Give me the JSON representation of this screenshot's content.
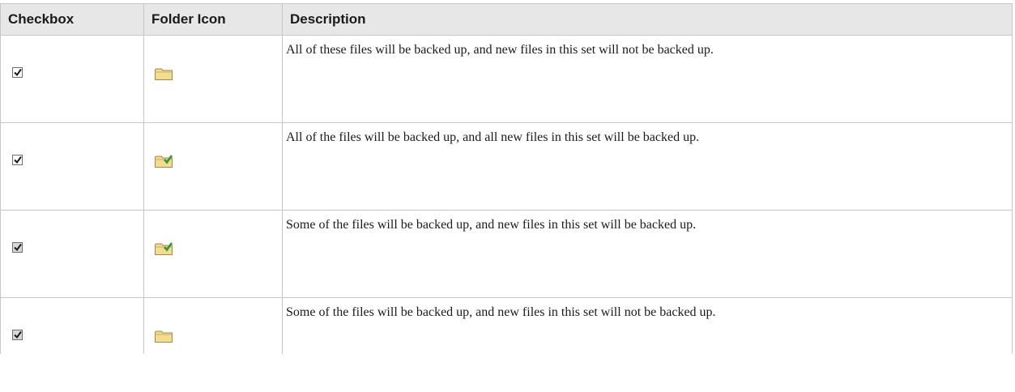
{
  "table": {
    "headers": {
      "checkbox": "Checkbox",
      "folder_icon": "Folder Icon",
      "description": "Description"
    },
    "rows": [
      {
        "checkbox_state": "checked",
        "folder_icon": "folder-icon",
        "description": "All of these files will be backed up, and new files in this set will not be backed up."
      },
      {
        "checkbox_state": "checked",
        "folder_icon": "folder-check-icon",
        "description": "All of the files will be backed up, and all new files in this set will be backed up."
      },
      {
        "checkbox_state": "partial",
        "folder_icon": "folder-check-icon",
        "description": "Some of the files will be backed up, and new files in this set will be backed up."
      },
      {
        "checkbox_state": "partial",
        "folder_icon": "folder-icon",
        "description": "Some of the files will be backed up, and new files in this set will not be backed up."
      }
    ]
  },
  "colors": {
    "header_bg": "#e7e7e7",
    "border": "#c6c6c6",
    "folder_fill": "#f3dc8e",
    "check_green": "#2e9a2e"
  }
}
